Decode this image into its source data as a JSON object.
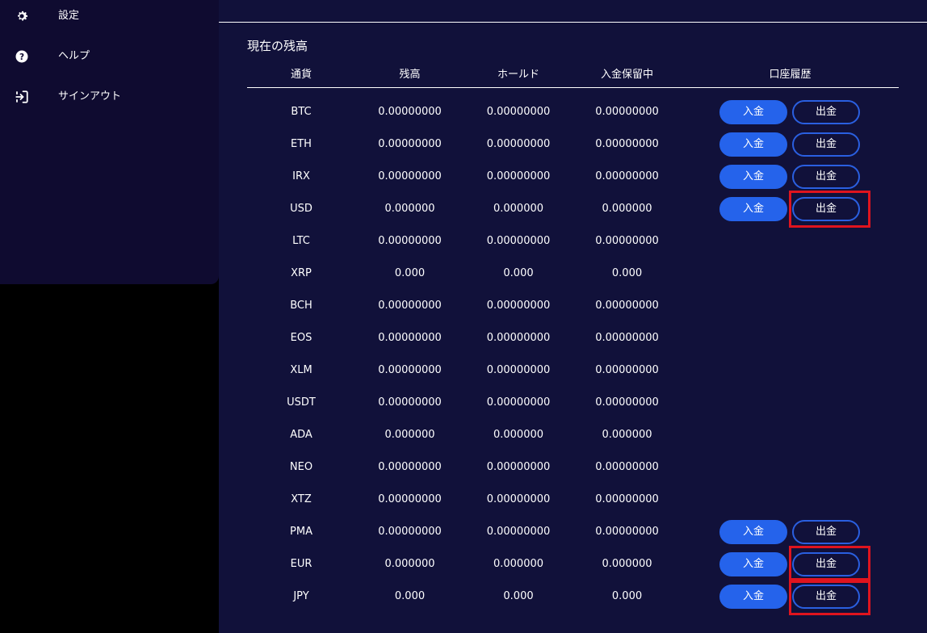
{
  "sidebar": {
    "items": [
      {
        "label": "設定",
        "icon": "gear-icon"
      },
      {
        "label": "ヘルプ",
        "icon": "question-circle-icon"
      },
      {
        "label": "サインアウト",
        "icon": "sign-out-icon"
      }
    ]
  },
  "balance": {
    "title": "現在の残高",
    "headers": {
      "currency": "通貨",
      "balance": "残高",
      "hold": "ホールド",
      "pending": "入金保留中",
      "history": "口座履歴"
    },
    "deposit_label": "入金",
    "withdraw_label": "出金",
    "rows": [
      {
        "currency": "BTC",
        "balance": "0.00000000",
        "hold": "0.00000000",
        "pending": "0.00000000",
        "buttons": true
      },
      {
        "currency": "ETH",
        "balance": "0.00000000",
        "hold": "0.00000000",
        "pending": "0.00000000",
        "buttons": true
      },
      {
        "currency": "IRX",
        "balance": "0.00000000",
        "hold": "0.00000000",
        "pending": "0.00000000",
        "buttons": true
      },
      {
        "currency": "USD",
        "balance": "0.000000",
        "hold": "0.000000",
        "pending": "0.000000",
        "buttons": true,
        "highlight_withdraw": true
      },
      {
        "currency": "LTC",
        "balance": "0.00000000",
        "hold": "0.00000000",
        "pending": "0.00000000",
        "buttons": false
      },
      {
        "currency": "XRP",
        "balance": "0.000",
        "hold": "0.000",
        "pending": "0.000",
        "buttons": false
      },
      {
        "currency": "BCH",
        "balance": "0.00000000",
        "hold": "0.00000000",
        "pending": "0.00000000",
        "buttons": false
      },
      {
        "currency": "EOS",
        "balance": "0.00000000",
        "hold": "0.00000000",
        "pending": "0.00000000",
        "buttons": false
      },
      {
        "currency": "XLM",
        "balance": "0.00000000",
        "hold": "0.00000000",
        "pending": "0.00000000",
        "buttons": false
      },
      {
        "currency": "USDT",
        "balance": "0.00000000",
        "hold": "0.00000000",
        "pending": "0.00000000",
        "buttons": false
      },
      {
        "currency": "ADA",
        "balance": "0.000000",
        "hold": "0.000000",
        "pending": "0.000000",
        "buttons": false
      },
      {
        "currency": "NEO",
        "balance": "0.00000000",
        "hold": "0.00000000",
        "pending": "0.00000000",
        "buttons": false
      },
      {
        "currency": "XTZ",
        "balance": "0.00000000",
        "hold": "0.00000000",
        "pending": "0.00000000",
        "buttons": false
      },
      {
        "currency": "PMA",
        "balance": "0.00000000",
        "hold": "0.00000000",
        "pending": "0.00000000",
        "buttons": true
      },
      {
        "currency": "EUR",
        "balance": "0.000000",
        "hold": "0.000000",
        "pending": "0.000000",
        "buttons": true,
        "highlight_withdraw": true
      },
      {
        "currency": "JPY",
        "balance": "0.000",
        "hold": "0.000",
        "pending": "0.000",
        "buttons": true,
        "highlight_withdraw": true
      }
    ]
  },
  "colors": {
    "sidebar_bg": "#0f0b30",
    "main_bg": "#11113a",
    "deposit_button": "#2563eb",
    "withdraw_border": "#2a5fe0",
    "highlight": "#e0141e"
  }
}
